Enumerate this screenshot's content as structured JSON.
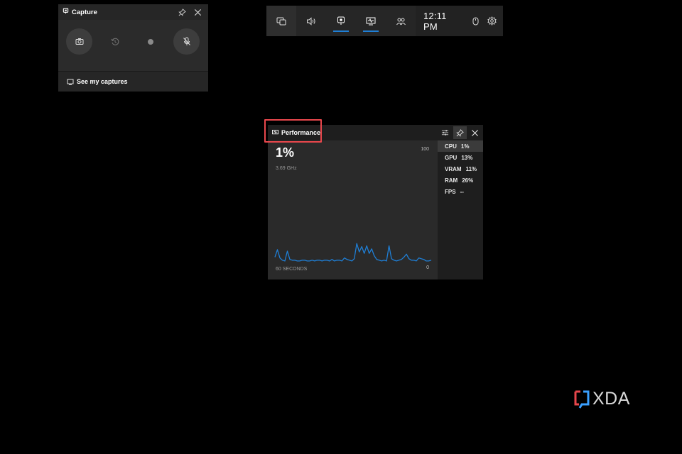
{
  "capture": {
    "title": "Capture",
    "footer_label": "See my captures",
    "buttons": [
      {
        "name": "screenshot",
        "icon": "camera-icon"
      },
      {
        "name": "record-last",
        "icon": "rewind-clock-icon"
      },
      {
        "name": "record",
        "icon": "record-dot-icon"
      },
      {
        "name": "mic",
        "icon": "mic-off-icon"
      }
    ]
  },
  "topbar": {
    "time": "12:11 PM",
    "items": [
      {
        "name": "widget-menu",
        "icon": "widget-menu-icon"
      },
      {
        "name": "audio",
        "icon": "speaker-icon"
      },
      {
        "name": "capture",
        "icon": "capture-icon",
        "active": true
      },
      {
        "name": "performance",
        "icon": "performance-icon",
        "active": true
      },
      {
        "name": "social",
        "icon": "people-icon"
      },
      {
        "name": "mouse",
        "icon": "mouse-icon"
      },
      {
        "name": "settings",
        "icon": "gear-icon"
      }
    ]
  },
  "performance": {
    "title": "Performance",
    "value": "1%",
    "frequency": "3.69 GHz",
    "y_max": "100",
    "y_min": "0",
    "x_label": "60 SECONDS",
    "accent": "#1f7fd6",
    "metrics": [
      {
        "name": "CPU",
        "value": "1%",
        "selected": true
      },
      {
        "name": "GPU",
        "value": "13%"
      },
      {
        "name": "VRAM",
        "value": "11%"
      },
      {
        "name": "RAM",
        "value": "26%"
      },
      {
        "name": "FPS",
        "value": "--"
      }
    ],
    "cpu_history": [
      7,
      17,
      6,
      3,
      2,
      15,
      4,
      3,
      3,
      2,
      2,
      3,
      3,
      2,
      2,
      3,
      2,
      3,
      3,
      2,
      3,
      3,
      2,
      4,
      2,
      3,
      3,
      2,
      6,
      4,
      3,
      2,
      5,
      25,
      14,
      21,
      12,
      22,
      12,
      18,
      9,
      4,
      3,
      2,
      3,
      2,
      22,
      5,
      3,
      2,
      3,
      4,
      7,
      11,
      5,
      3,
      3,
      2,
      6,
      5,
      4,
      2,
      2,
      3
    ]
  },
  "watermark": {
    "text": "XDA",
    "colors": [
      "#e8474c",
      "#3aa0ff"
    ]
  }
}
